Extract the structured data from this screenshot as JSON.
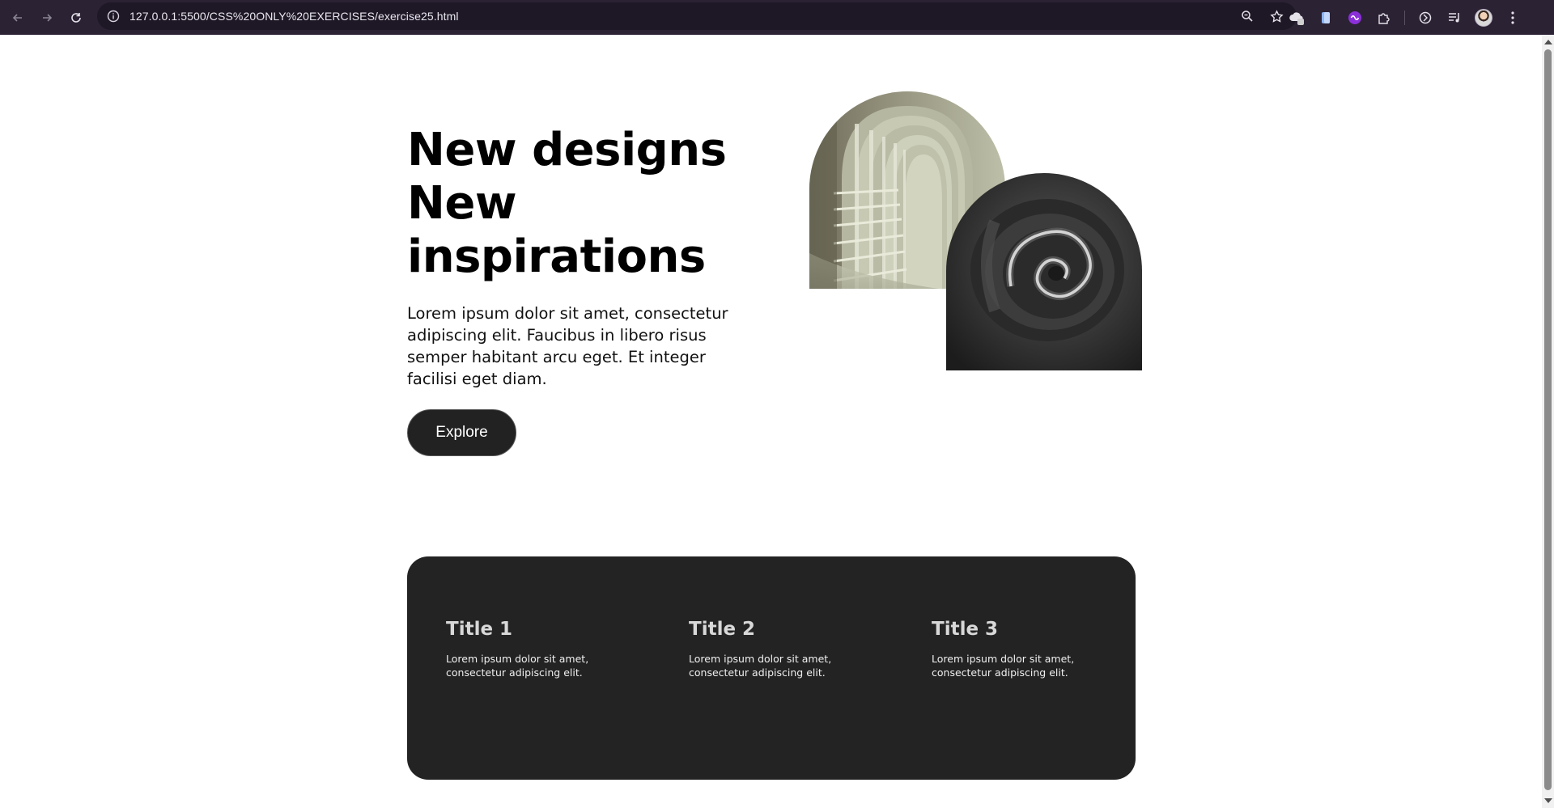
{
  "browser": {
    "url": "127.0.0.1:5500/CSS%20ONLY%20EXERCISES/exercise25.html",
    "back_icon": "arrow-left-icon",
    "forward_icon": "arrow-right-icon",
    "reload_icon": "reload-icon",
    "zoom_icon": "zoom-icon",
    "bookmark_icon": "star-icon"
  },
  "hero": {
    "title_line1": "New designs",
    "title_line2": "New",
    "title_line3": "inspirations",
    "description": "Lorem ipsum dolor sit amet, consectetur adipiscing elit. Faucibus in libero risus semper habitant arcu eget. Et integer facilisi eget diam.",
    "button_label": "Explore"
  },
  "features": [
    {
      "title": "Title 1",
      "text": "Lorem ipsum dolor sit amet, consectetur adipiscing elit."
    },
    {
      "title": "Title 2",
      "text": "Lorem ipsum dolor sit amet, consectetur adipiscing elit."
    },
    {
      "title": "Title 3",
      "text": "Lorem ipsum dolor sit amet, consectetur adipiscing elit."
    }
  ],
  "colors": {
    "chrome_bg": "#2b2234",
    "button_bg": "#222222",
    "features_bg": "#232323"
  }
}
